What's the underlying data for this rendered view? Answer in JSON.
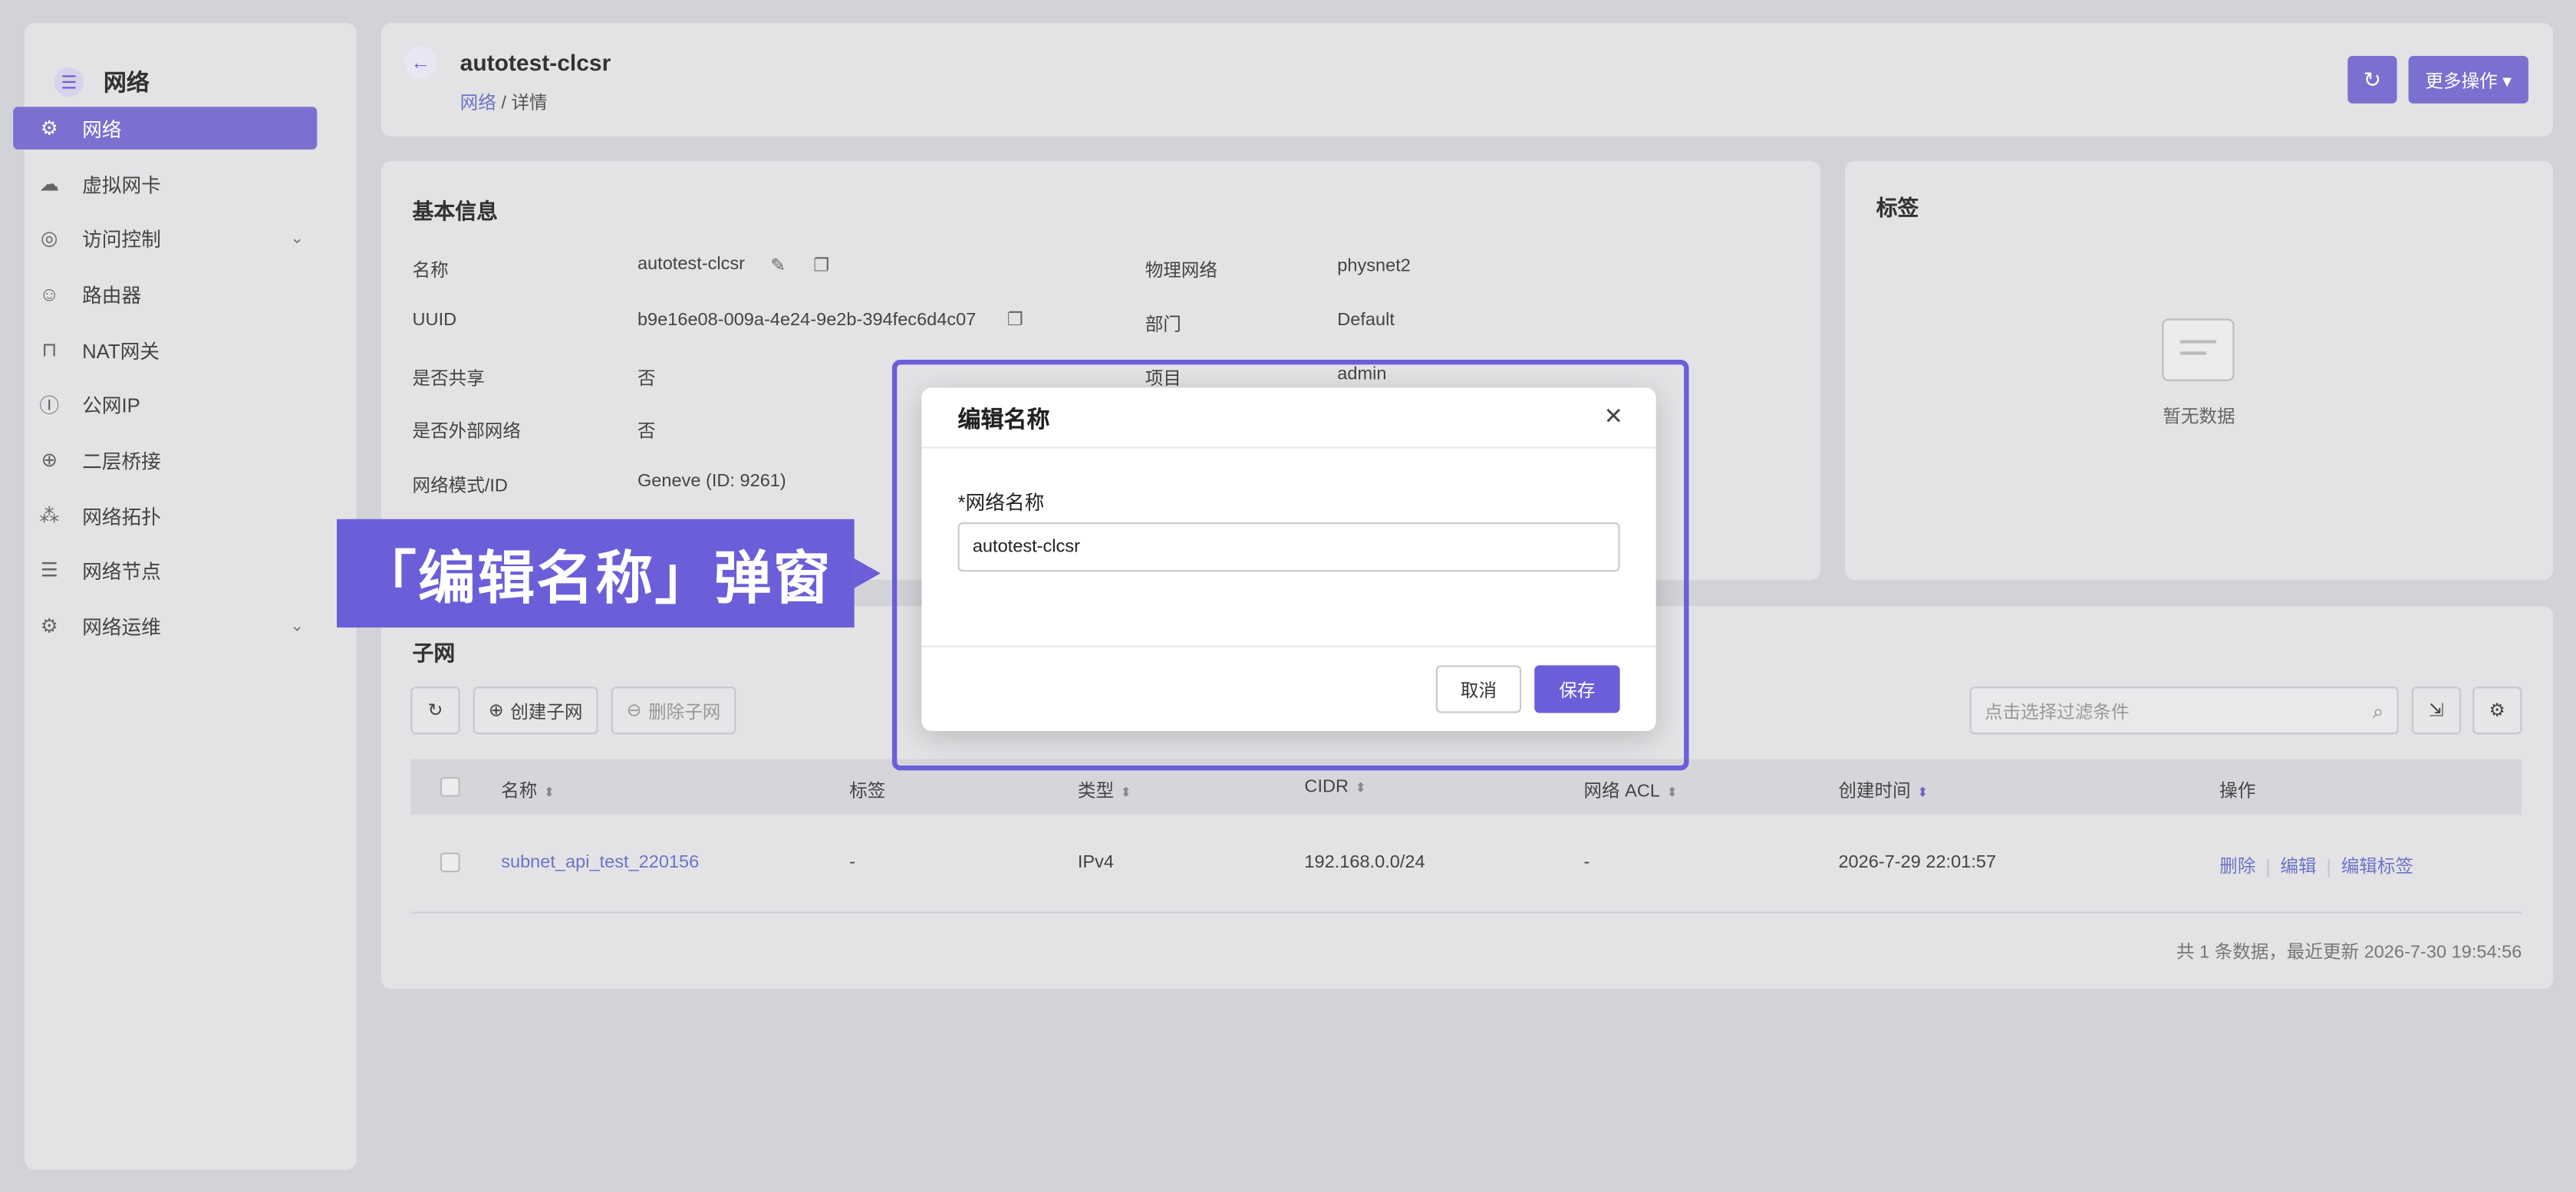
{
  "sidebar": {
    "title": "网络",
    "items": [
      {
        "label": "网络",
        "icon": "network-icon",
        "glyph": "⚙"
      },
      {
        "label": "虚拟网卡",
        "icon": "cloud-icon",
        "glyph": "☁"
      },
      {
        "label": "访问控制",
        "icon": "shield-icon",
        "glyph": "◎"
      },
      {
        "label": "路由器",
        "icon": "router-icon",
        "glyph": "☺"
      },
      {
        "label": "NAT网关",
        "icon": "gateway-icon",
        "glyph": "⊓"
      },
      {
        "label": "公网IP",
        "icon": "ip-icon",
        "glyph": "Ⓘ"
      },
      {
        "label": "二层桥接",
        "icon": "bridge-icon",
        "glyph": "⊕"
      },
      {
        "label": "网络拓扑",
        "icon": "topology-icon",
        "glyph": "⁂"
      },
      {
        "label": "网络节点",
        "icon": "server-icon",
        "glyph": "☰"
      },
      {
        "label": "网络运维",
        "icon": "ops-icon",
        "glyph": "⚙"
      }
    ]
  },
  "header": {
    "title": "autotest-clcsr",
    "breadcrumb_link": "网络",
    "breadcrumb_sep": "/",
    "breadcrumb_current": "详情",
    "more_label": "更多操作 ▾"
  },
  "info": {
    "title": "基本信息",
    "fields": [
      {
        "key": "名称",
        "value": "autotest-clcsr"
      },
      {
        "key": "UUID",
        "value": "b9e16e08-009a-4e24-9e2b-394fec6d4c07"
      },
      {
        "key": "是否共享",
        "value": "否"
      },
      {
        "key": "是否外部网络",
        "value": "否"
      },
      {
        "key": "网络模式/ID",
        "value": "Geneve (ID: 9261)"
      }
    ],
    "fields_right": [
      {
        "key": "物理网络",
        "value": "physnet2"
      },
      {
        "key": "部门",
        "value": "Default"
      },
      {
        "key": "项目",
        "value": "admin"
      }
    ]
  },
  "tags": {
    "title": "标签",
    "empty_text": "暂无数据"
  },
  "subnet": {
    "title": "子网",
    "create_label": "创建子网",
    "delete_label": "删除子网",
    "filter_placeholder": "点击选择过滤条件",
    "columns": [
      "名称",
      "标签",
      "类型",
      "CIDR",
      "网络 ACL",
      "创建时间",
      "操作"
    ],
    "rows": [
      {
        "name": "subnet_api_test_220156",
        "tag": "-",
        "type": "IPv4",
        "cidr": "192.168.0.0/24",
        "acl": "-",
        "created": "2026-7-29 22:01:57",
        "op_delete": "删除",
        "op_edit": "编辑",
        "op_edit_tag": "编辑标签"
      }
    ],
    "footer": "共 1 条数据，最近更新  2026-7-30 19:54:56"
  },
  "callout": {
    "text": "「编辑名称」弹窗"
  },
  "modal": {
    "title": "编辑名称",
    "field_label": "*网络名称",
    "field_value": "autotest-clcsr",
    "cancel_label": "取消",
    "save_label": "保存"
  },
  "colors": {
    "accent": "#6a5ed9",
    "link": "#6b74c7"
  }
}
